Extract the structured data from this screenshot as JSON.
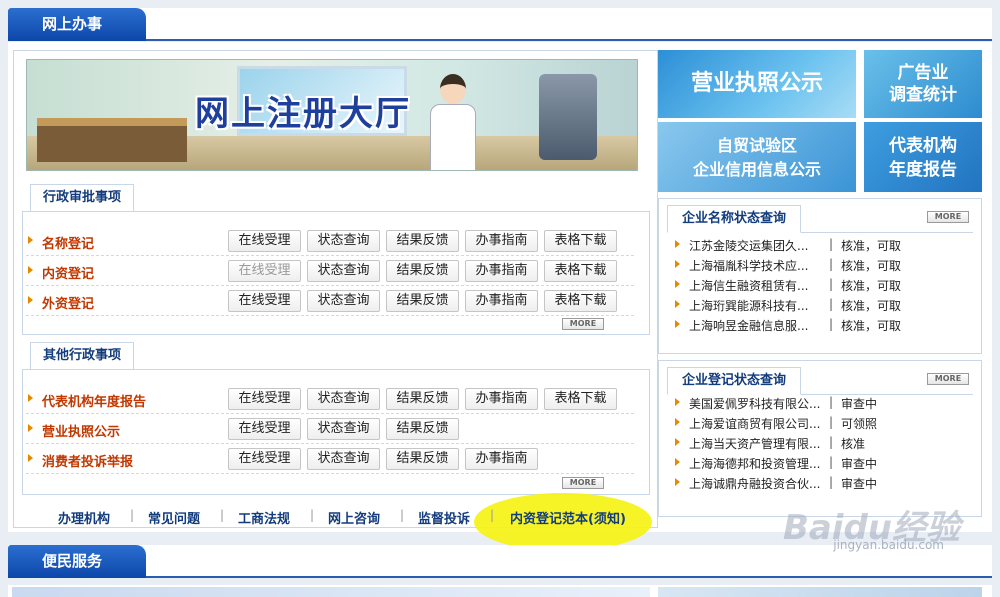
{
  "sections": {
    "online_office": "网上办事",
    "public_service": "便民服务"
  },
  "banner": {
    "title": "网上注册大厅"
  },
  "admin_approval": {
    "tab": "行政审批事项",
    "rows": [
      {
        "label": "名称登记",
        "buttons": [
          "在线受理",
          "状态查询",
          "结果反馈",
          "办事指南",
          "表格下载"
        ],
        "first_disabled": false
      },
      {
        "label": "内资登记",
        "buttons": [
          "在线受理",
          "状态查询",
          "结果反馈",
          "办事指南",
          "表格下载"
        ],
        "first_disabled": true
      },
      {
        "label": "外资登记",
        "buttons": [
          "在线受理",
          "状态查询",
          "结果反馈",
          "办事指南",
          "表格下载"
        ],
        "first_disabled": false
      }
    ],
    "more": "MORE"
  },
  "other_admin": {
    "tab": "其他行政事项",
    "rows": [
      {
        "label": "代表机构年度报告",
        "buttons": [
          "在线受理",
          "状态查询",
          "结果反馈",
          "办事指南",
          "表格下载"
        ]
      },
      {
        "label": "营业执照公示",
        "buttons": [
          "在线受理",
          "状态查询",
          "结果反馈"
        ]
      },
      {
        "label": "消费者投诉举报",
        "buttons": [
          "在线受理",
          "状态查询",
          "结果反馈",
          "办事指南"
        ]
      }
    ],
    "more": "MORE"
  },
  "bottom_links": [
    "办理机构",
    "常见问题",
    "工商法规",
    "网上咨询",
    "监督投诉",
    "内资登记范本(须知)"
  ],
  "ads": {
    "license_public": "营业执照公示",
    "ad_survey_line1": "广告业",
    "ad_survey_line2": "调查统计",
    "ftz_line1": "自贸试验区",
    "ftz_line2": "企业信用信息公示",
    "rep_line1": "代表机构",
    "rep_line2": "年度报告"
  },
  "name_status": {
    "tab": "企业名称状态查询",
    "more": "MORE",
    "items": [
      {
        "name": "江苏金陵交运集团久...",
        "status": "核准，可取"
      },
      {
        "name": "上海福胤科学技术应...",
        "status": "核准，可取"
      },
      {
        "name": "上海信生融资租赁有...",
        "status": "核准，可取"
      },
      {
        "name": "上海珩巽能源科技有...",
        "status": "核准，可取"
      },
      {
        "name": "上海响昱金融信息服...",
        "status": "核准，可取"
      }
    ]
  },
  "reg_status": {
    "tab": "企业登记状态查询",
    "more": "MORE",
    "items": [
      {
        "name": "美国爱佩罗科技有限公...",
        "status": "审查中"
      },
      {
        "name": "上海爱谊商贸有限公司...",
        "status": "可领照"
      },
      {
        "name": "上海当天资产管理有限...",
        "status": "核准"
      },
      {
        "name": "上海海德邦和投资管理...",
        "status": "审查中"
      },
      {
        "name": "上海诚鼎舟融投资合伙...",
        "status": "审查中"
      }
    ]
  },
  "watermark": {
    "logo": "Baidu经验",
    "url": "jingyan.baidu.com"
  },
  "colors": {
    "brand_blue": "#0c47a8",
    "link_red": "#c23800",
    "arrow_orange": "#e38a00",
    "highlight": "#f6f21a"
  }
}
